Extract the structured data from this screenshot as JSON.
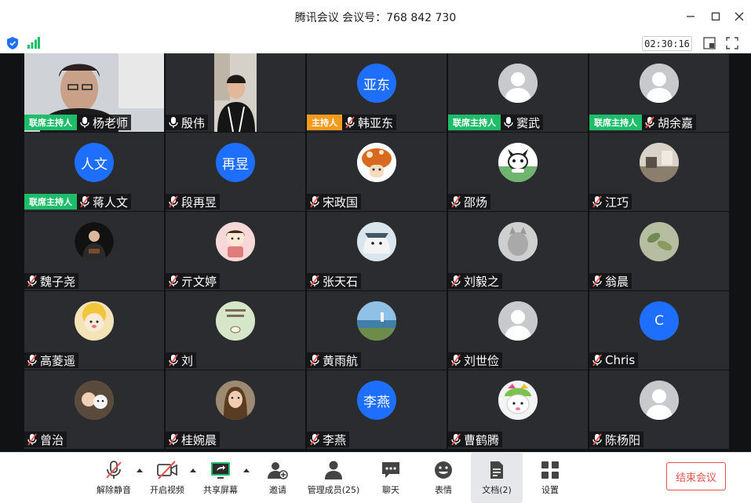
{
  "window": {
    "title": "腾讯会议 会议号：768 842 730",
    "timer": "02:30:16"
  },
  "colors": {
    "host_badge": "#1ebd6a",
    "main_host_badge": "#f29b1c",
    "avatar_blue": "#1e6fff",
    "end_meeting": "#e6554d"
  },
  "participants": [
    {
      "name": "杨老师",
      "role": "联席主持人",
      "kind": "video",
      "mic": "on"
    },
    {
      "name": "殷伟",
      "role": "",
      "kind": "video",
      "mic": "on"
    },
    {
      "name": "韩亚东",
      "role": "主持人",
      "kind": "initials",
      "initials": "亚东",
      "mic": "muted"
    },
    {
      "name": "窦武",
      "role": "联席主持人",
      "kind": "default",
      "mic": "on"
    },
    {
      "name": "胡余嘉",
      "role": "联席主持人",
      "kind": "default",
      "mic": "muted"
    },
    {
      "name": "蒋人文",
      "role": "联席主持人",
      "kind": "initials",
      "initials": "人文",
      "mic": "muted"
    },
    {
      "name": "段再昱",
      "role": "",
      "kind": "initials",
      "initials": "再昱",
      "mic": "muted"
    },
    {
      "name": "宋政国",
      "role": "",
      "kind": "photo",
      "icon": "mushroom-avatar",
      "mic": "muted"
    },
    {
      "name": "邵炀",
      "role": "",
      "kind": "photo",
      "icon": "husky-avatar",
      "mic": "muted"
    },
    {
      "name": "江巧",
      "role": "",
      "kind": "photo",
      "icon": "room-photo-avatar",
      "mic": "muted"
    },
    {
      "name": "魏子尧",
      "role": "",
      "kind": "photo",
      "icon": "godfather-avatar",
      "mic": "muted"
    },
    {
      "name": "亓文婷",
      "role": "",
      "kind": "photo",
      "icon": "cartoon-girl-avatar",
      "mic": "muted"
    },
    {
      "name": "张天石",
      "role": "",
      "kind": "photo",
      "icon": "bear-avatar",
      "mic": "muted"
    },
    {
      "name": "刘毅之",
      "role": "",
      "kind": "photo",
      "icon": "cat-avatar",
      "mic": "muted"
    },
    {
      "name": "翁晨",
      "role": "",
      "kind": "photo",
      "icon": "leaves-avatar",
      "mic": "muted"
    },
    {
      "name": "高菱遥",
      "role": "",
      "kind": "photo",
      "icon": "baby-avatar",
      "mic": "muted"
    },
    {
      "name": "刘",
      "role": "",
      "kind": "photo",
      "icon": "green-card-avatar",
      "mic": "muted"
    },
    {
      "name": "黄雨航",
      "role": "",
      "kind": "photo",
      "icon": "seaside-avatar",
      "mic": "muted"
    },
    {
      "name": "刘世俭",
      "role": "",
      "kind": "default",
      "mic": "muted"
    },
    {
      "name": "Chris",
      "role": "",
      "kind": "initials",
      "initials": "C",
      "mic": "muted"
    },
    {
      "name": "曾治",
      "role": "",
      "kind": "photo",
      "icon": "kids-dog-avatar",
      "mic": "muted"
    },
    {
      "name": "桂婉晨",
      "role": "",
      "kind": "photo",
      "icon": "woman-avatar",
      "mic": "muted"
    },
    {
      "name": "李燕",
      "role": "",
      "kind": "initials",
      "initials": "李燕",
      "mic": "muted"
    },
    {
      "name": "曹鹤腾",
      "role": "",
      "kind": "photo",
      "icon": "sad-cartoon-avatar",
      "mic": "muted"
    },
    {
      "name": "陈杨阳",
      "role": "",
      "kind": "default",
      "mic": "muted"
    }
  ],
  "toolbar": {
    "unmute": "解除静音",
    "start_video": "开启视频",
    "share_screen": "共享屏幕",
    "invite": "邀请",
    "manage_members": "管理成员(25)",
    "chat": "聊天",
    "reactions": "表情",
    "documents": "文档(2)",
    "settings": "设置",
    "end_meeting": "结束会议"
  }
}
